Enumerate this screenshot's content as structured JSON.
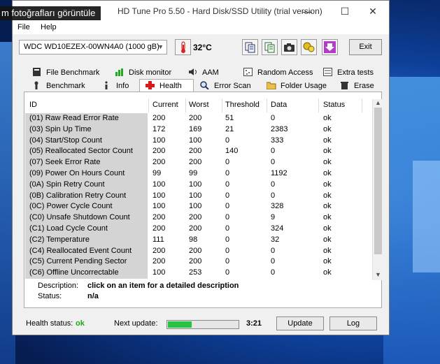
{
  "tooltip": "m fotoğrafları görüntüle",
  "window": {
    "title": "HD Tune Pro 5.50 - Hard Disk/SSD Utility (trial version)"
  },
  "menu": {
    "file": "File",
    "help": "Help"
  },
  "toolbar": {
    "drive": "WDC WD10EZEX-00WN4A0 (1000 gB)",
    "temperature": "32°C",
    "exit": "Exit"
  },
  "tabs": {
    "row1": [
      "File Benchmark",
      "Disk monitor",
      "AAM",
      "Random Access",
      "Extra tests"
    ],
    "row2": [
      "Benchmark",
      "Info",
      "Health",
      "Error Scan",
      "Folder Usage",
      "Erase"
    ]
  },
  "columns": [
    "ID",
    "Current",
    "Worst",
    "Threshold",
    "Data",
    "Status"
  ],
  "rows": [
    [
      "(01) Raw Read Error Rate",
      "200",
      "200",
      "51",
      "0",
      "ok"
    ],
    [
      "(03) Spin Up Time",
      "172",
      "169",
      "21",
      "2383",
      "ok"
    ],
    [
      "(04) Start/Stop Count",
      "100",
      "100",
      "0",
      "333",
      "ok"
    ],
    [
      "(05) Reallocated Sector Count",
      "200",
      "200",
      "140",
      "0",
      "ok"
    ],
    [
      "(07) Seek Error Rate",
      "200",
      "200",
      "0",
      "0",
      "ok"
    ],
    [
      "(09) Power On Hours Count",
      "99",
      "99",
      "0",
      "1192",
      "ok"
    ],
    [
      "(0A) Spin Retry Count",
      "100",
      "100",
      "0",
      "0",
      "ok"
    ],
    [
      "(0B) Calibration Retry Count",
      "100",
      "100",
      "0",
      "0",
      "ok"
    ],
    [
      "(0C) Power Cycle Count",
      "100",
      "100",
      "0",
      "328",
      "ok"
    ],
    [
      "(C0) Unsafe Shutdown Count",
      "200",
      "200",
      "0",
      "9",
      "ok"
    ],
    [
      "(C1) Load Cycle Count",
      "200",
      "200",
      "0",
      "324",
      "ok"
    ],
    [
      "(C2) Temperature",
      "111",
      "98",
      "0",
      "32",
      "ok"
    ],
    [
      "(C4) Reallocated Event Count",
      "200",
      "200",
      "0",
      "0",
      "ok"
    ],
    [
      "(C5) Current Pending Sector",
      "200",
      "200",
      "0",
      "0",
      "ok"
    ],
    [
      "(C6) Offline Uncorrectable",
      "100",
      "253",
      "0",
      "0",
      "ok"
    ]
  ],
  "details": {
    "description_label": "Description:",
    "description": "click on an item for a detailed description",
    "status_label": "Status:",
    "status": "n/a"
  },
  "footer": {
    "health_label": "Health status:",
    "health_value": "ok",
    "next_update_label": "Next update:",
    "next_update_time": "3:21",
    "update_progress": 0.33,
    "update_button": "Update",
    "log_button": "Log"
  },
  "colors": {
    "health_ok": "#1aa81a",
    "progress": "#27c441",
    "health_tab_icon": "#d91a1a"
  }
}
